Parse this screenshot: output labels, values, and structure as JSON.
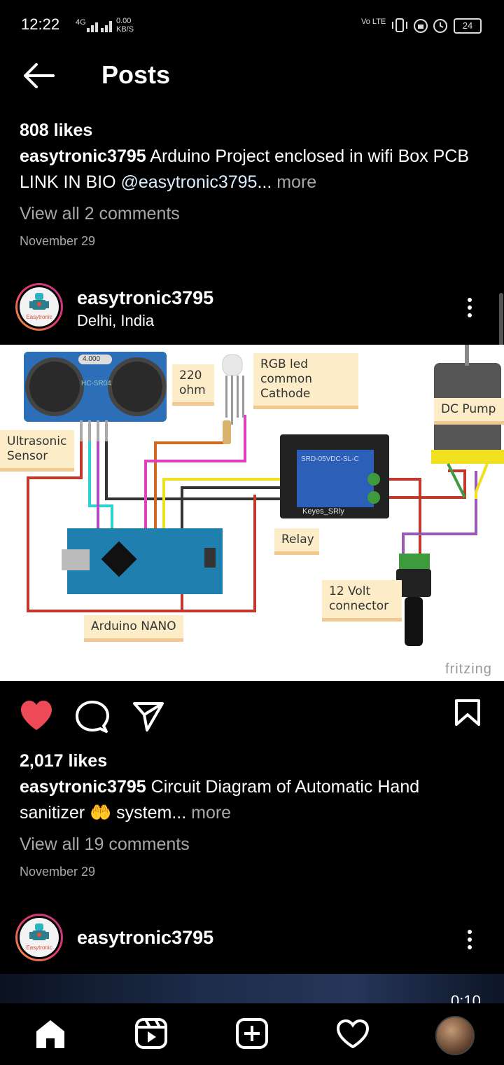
{
  "status_bar": {
    "time": "12:22",
    "network": "4G",
    "speed_value": "0.00",
    "speed_unit": "KB/S",
    "carrier": "Vo LTE",
    "battery": "24"
  },
  "header": {
    "title": "Posts"
  },
  "post1": {
    "likes": "808 likes",
    "username": "easytronic3795",
    "caption": "Arduino Project enclosed in wifi Box PCB LINK IN BIO",
    "mention": "@easytronic3795",
    "ellipsis": "...",
    "more": "more",
    "comments": "View all 2 comments",
    "date": "November 29"
  },
  "post2": {
    "username": "easytronic3795",
    "location": "Delhi, India",
    "avatar_text": "Easytronic",
    "image_labels": {
      "sensor_module": "HC-SR04",
      "sensor_value": "4.000",
      "resistor": "220\nohm",
      "rgb": "RGB led\ncommon\nCathode",
      "pump": "DC Pump",
      "ultrasonic": "Ultrasonic\nSensor",
      "relay": "Relay",
      "relay_module": "Keyes_SRly",
      "relay_part": "SRD-05VDC-SL-C",
      "connector": "12 Volt\nconnector",
      "nano": "Arduino NANO",
      "brand": "fritzing"
    },
    "likes": "2,017 likes",
    "caption": "Circuit Diagram of Automatic Hand sanitizer",
    "emoji": "🤲",
    "caption_tail": "system",
    "ellipsis": "...",
    "more": "more",
    "comments": "View all 19 comments",
    "date": "November 29",
    "liked": true
  },
  "post3": {
    "username": "easytronic3795",
    "avatar_text": "Easytronic",
    "video_time": "0:10"
  },
  "colors": {
    "background": "#000000",
    "like_red": "#ed4956",
    "muted_text": "#a8a8a8"
  },
  "bottom_nav": {
    "items": [
      "home-icon",
      "reels-icon",
      "new-post-icon",
      "activity-icon",
      "profile-avatar"
    ]
  }
}
